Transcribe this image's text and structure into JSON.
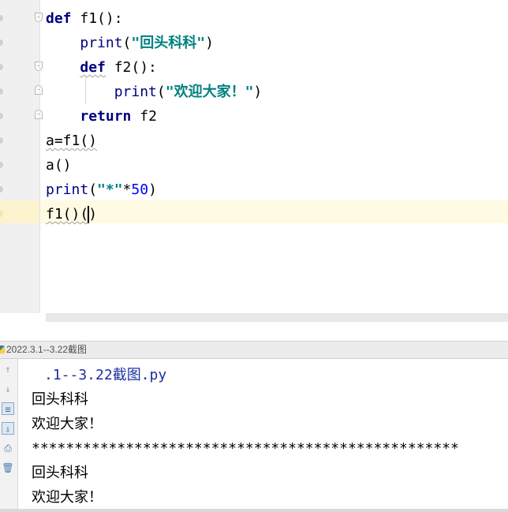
{
  "editor": {
    "lines": [
      {
        "parts": [
          {
            "t": "def",
            "c": "kw"
          },
          {
            "t": " f1():",
            "c": ""
          }
        ]
      },
      {
        "parts": [
          {
            "t": "    ",
            "c": ""
          },
          {
            "t": "print",
            "c": "bi"
          },
          {
            "t": "(",
            "c": ""
          },
          {
            "t": "\"回头科科\"",
            "c": "str"
          },
          {
            "t": ")",
            "c": ""
          }
        ]
      },
      {
        "parts": [
          {
            "t": "    ",
            "c": ""
          },
          {
            "t": "def",
            "c": "kw squiggle"
          },
          {
            "t": " f2():",
            "c": ""
          }
        ]
      },
      {
        "parts": [
          {
            "t": "        ",
            "c": ""
          },
          {
            "t": "print",
            "c": "bi"
          },
          {
            "t": "(",
            "c": ""
          },
          {
            "t": "\"欢迎大家！\"",
            "c": "str"
          },
          {
            "t": ")",
            "c": ""
          }
        ]
      },
      {
        "parts": [
          {
            "t": "    ",
            "c": ""
          },
          {
            "t": "return",
            "c": "kw"
          },
          {
            "t": " f2",
            "c": ""
          }
        ]
      },
      {
        "parts": [
          {
            "t": "a=f1()",
            "c": "squiggle"
          }
        ]
      },
      {
        "parts": [
          {
            "t": "a()",
            "c": ""
          }
        ]
      },
      {
        "parts": [
          {
            "t": "print",
            "c": "bi"
          },
          {
            "t": "(",
            "c": ""
          },
          {
            "t": "\"*\"",
            "c": "str"
          },
          {
            "t": "*",
            "c": ""
          },
          {
            "t": "50",
            "c": "num"
          },
          {
            "t": ")",
            "c": ""
          }
        ]
      },
      {
        "parts": [
          {
            "t": "f1()(",
            "c": "squiggle"
          },
          {
            "t": "CARET",
            "c": "caret"
          },
          {
            "t": ")",
            "c": ""
          }
        ]
      }
    ]
  },
  "run_panel": {
    "tab_title": "2022.3.1--3.22截图",
    "toolbar_icons": [
      "up-arrow-icon",
      "down-arrow-icon",
      "soft-wrap-icon",
      "scroll-to-end-icon",
      "print-icon",
      "trash-icon"
    ]
  },
  "console": {
    "lines": [
      ".1--3.22截图.py",
      "回头科科",
      "欢迎大家！",
      "**************************************************",
      "回头科科",
      "欢迎大家！"
    ]
  }
}
